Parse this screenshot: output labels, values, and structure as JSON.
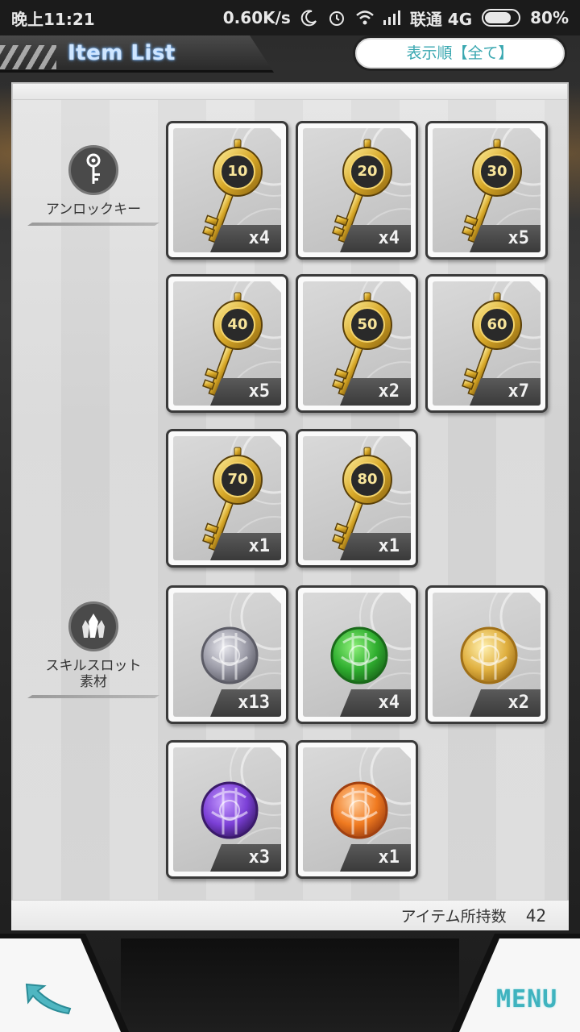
{
  "status_bar": {
    "time": "晚上11:21",
    "network_speed": "0.60K/s",
    "carrier": "联通 4G",
    "battery": "80%",
    "battery_level": 0.8
  },
  "header": {
    "title": "Item List",
    "sort_button": "表示順【全て】"
  },
  "categories": [
    {
      "label": "アンロックキー",
      "icon": "key-icon"
    },
    {
      "label": "スキルスロット\n素材",
      "icon": "crystal-icon"
    }
  ],
  "items": [
    {
      "type": "key",
      "number": "10",
      "count": "x4"
    },
    {
      "type": "key",
      "number": "20",
      "count": "x4"
    },
    {
      "type": "key",
      "number": "30",
      "count": "x5"
    },
    {
      "type": "key",
      "number": "40",
      "count": "x5"
    },
    {
      "type": "key",
      "number": "50",
      "count": "x2"
    },
    {
      "type": "key",
      "number": "60",
      "count": "x7"
    },
    {
      "type": "key",
      "number": "70",
      "count": "x1"
    },
    {
      "type": "key",
      "number": "80",
      "count": "x1"
    },
    {
      "type": "orb",
      "variant": "silver",
      "count": "x13"
    },
    {
      "type": "orb",
      "variant": "green",
      "count": "x4"
    },
    {
      "type": "orb",
      "variant": "gold",
      "count": "x2"
    },
    {
      "type": "orb",
      "variant": "purple",
      "count": "x3"
    },
    {
      "type": "orb",
      "variant": "orange",
      "count": "x1"
    }
  ],
  "footer": {
    "item_count_label": "アイテム所持数",
    "item_count_value": "42"
  },
  "nav": {
    "menu_label": "MENU",
    "back_icon": "back-arrow-icon"
  },
  "colors": {
    "accent": "#3fb3bf",
    "title_glow": "#5fa8ff"
  }
}
